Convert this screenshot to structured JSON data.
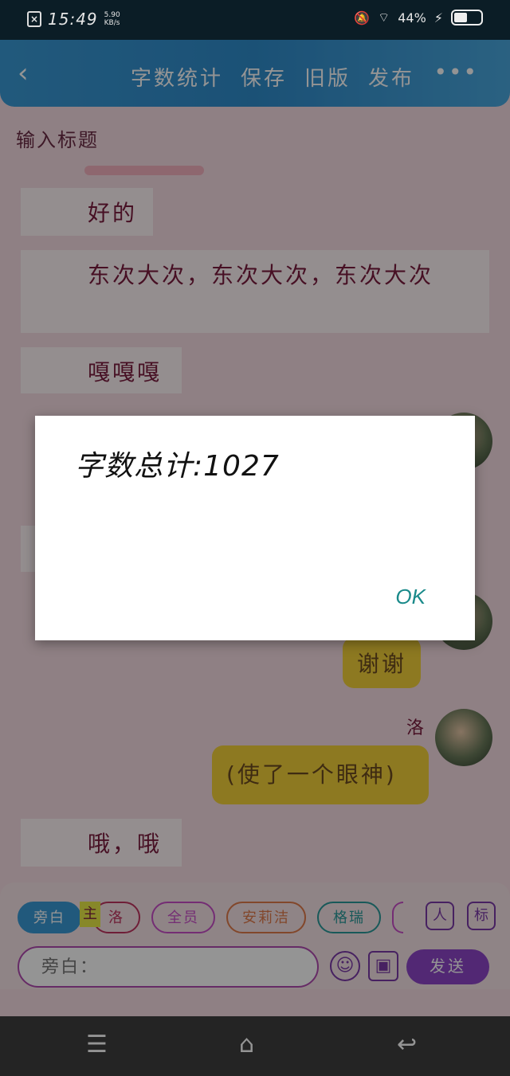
{
  "status_bar": {
    "time": "15:49",
    "speed_value": "5.90",
    "speed_unit": "KB/s",
    "battery": "44%"
  },
  "header": {
    "back_icon": "chevron-left-icon",
    "actions": [
      "字数统计",
      "保存",
      "旧版",
      "发布"
    ],
    "more_label": "•••"
  },
  "editor": {
    "title_placeholder": "输入标题",
    "messages": [
      {
        "side": "left",
        "text": "好的"
      },
      {
        "side": "left",
        "text": "东次大次，东次大次，东次大次"
      },
      {
        "side": "left",
        "text": "嘎嘎嘎"
      },
      {
        "side": "right",
        "text": "谢谢"
      },
      {
        "side": "right",
        "name": "洛",
        "text": "(使了一个眼神)"
      },
      {
        "side": "left",
        "text": "哦，哦"
      }
    ]
  },
  "composer": {
    "chips": [
      "旁白",
      "洛",
      "全员",
      "安莉洁",
      "格瑞"
    ],
    "main_mark": "主",
    "avatar_btn": "人",
    "tag_btn": "标",
    "input_placeholder": "旁白：",
    "send_label": "发送"
  },
  "navbar": {
    "menu": "☰",
    "home": "⌂",
    "back": "↩"
  },
  "dialog": {
    "message": "字数总计:1027",
    "ok_label": "OK"
  },
  "colors": {
    "header": "#3a9ad6",
    "send": "#8d46c9",
    "right_bubble": "#f3d03a"
  }
}
